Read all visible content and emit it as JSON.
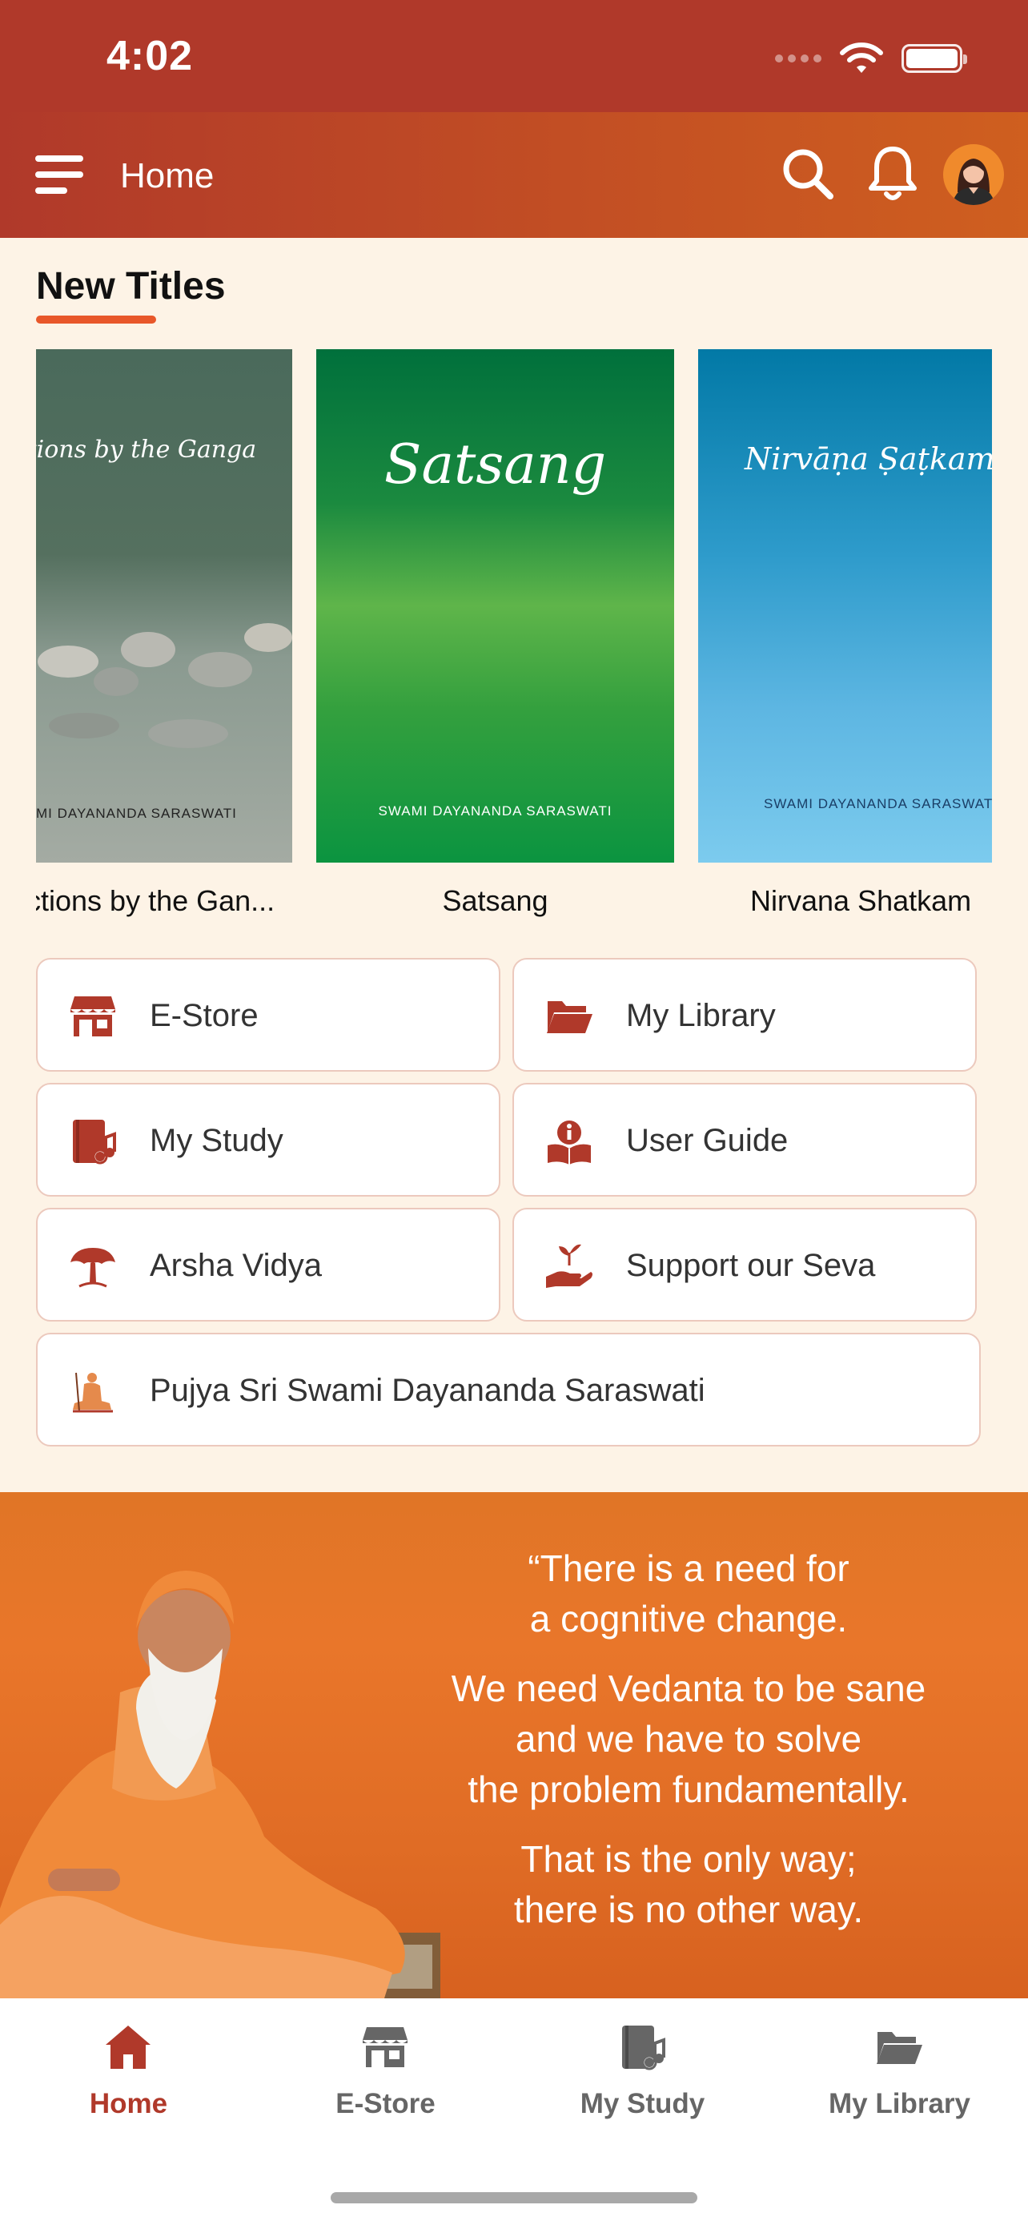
{
  "status_bar": {
    "time": "4:02"
  },
  "header": {
    "title": "Home"
  },
  "section": {
    "title": "New Titles"
  },
  "books": [
    {
      "caption": "ctions by the Gan...",
      "cover_title": "ections by the Ganga",
      "cover_author": "MI DAYANANDA SARASWATI"
    },
    {
      "caption": "Satsang",
      "cover_title": "Satsang",
      "cover_author": "SWAMI DAYANANDA SARASWATI"
    },
    {
      "caption": "Nirvana Shatkam",
      "cover_title": "Nirvāṇa Ṣaṭkam",
      "cover_author": "SWAMI DAYANANDA SARASWATI"
    }
  ],
  "menu": [
    {
      "label": "E-Store",
      "icon": "store-icon"
    },
    {
      "label": "My Library",
      "icon": "folder-icon"
    },
    {
      "label": "My Study",
      "icon": "music-book-icon"
    },
    {
      "label": "User Guide",
      "icon": "user-guide-icon"
    },
    {
      "label": "Arsha Vidya",
      "icon": "tree-icon"
    },
    {
      "label": "Support our Seva",
      "icon": "seedling-hand-icon"
    },
    {
      "label": "Pujya Sri Swami Dayananda Saraswati",
      "icon": "swami-icon"
    }
  ],
  "banner": {
    "quote_lines": [
      "“There is a need for",
      "a cognitive change.",
      "We need Vedanta to be sane",
      "and we have to solve",
      "the problem fundamentally.",
      "That is the only way;",
      "there is no other way."
    ]
  },
  "tabs": [
    {
      "label": "Home",
      "icon": "home-icon",
      "active": true
    },
    {
      "label": "E-Store",
      "icon": "store-icon",
      "active": false
    },
    {
      "label": "My Study",
      "icon": "music-book-icon",
      "active": false
    },
    {
      "label": "My Library",
      "icon": "folder-icon",
      "active": false
    }
  ],
  "colors": {
    "primary": "#b0392a",
    "accent": "#e8572a",
    "background": "#fdf3e6",
    "icon": "#b0392a"
  }
}
